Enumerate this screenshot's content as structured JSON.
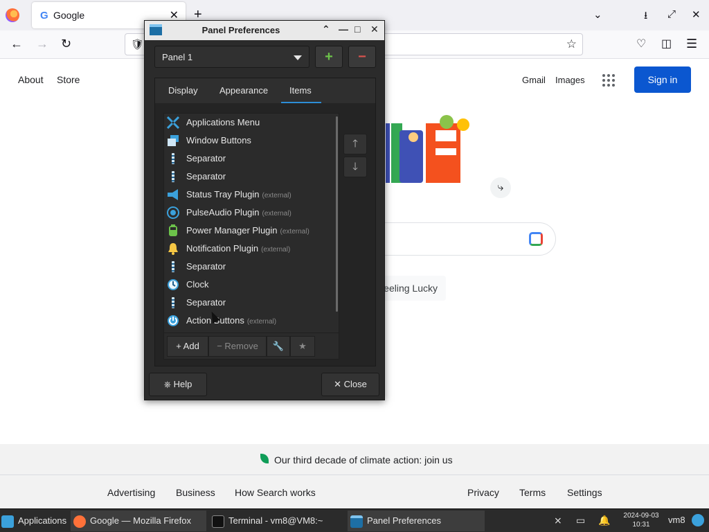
{
  "browser": {
    "tab_title": "Google",
    "favicon_letter": "G",
    "tab_close": "✕",
    "new_tab": "+",
    "icons": [
      "firefox-logo",
      "list-tabs-icon",
      "download-icon",
      "restore-icon",
      "close-icon",
      "back-icon",
      "forward-icon",
      "reload-icon",
      "shield-icon",
      "star-icon",
      "pocket-icon",
      "extensions-icon",
      "menu-icon"
    ]
  },
  "google": {
    "top_left": [
      "About",
      "Store"
    ],
    "top_right": [
      "Gmail",
      "Images"
    ],
    "sign_in": "Sign in",
    "lucky": "Feeling Lucky",
    "climate": "Our third decade of climate action: join us",
    "footer_left": [
      "Advertising",
      "Business",
      "How Search works"
    ],
    "footer_right": [
      "Privacy",
      "Terms",
      "Settings"
    ]
  },
  "dialog": {
    "title": "Panel Preferences",
    "panel_select": "Panel 1",
    "add_panel": "+",
    "remove_panel": "−",
    "tabs": [
      "Display",
      "Appearance",
      "Items"
    ],
    "active_tab": "Items",
    "items": [
      {
        "label": "Applications Menu",
        "ext": "",
        "icon": "applications-menu-icon"
      },
      {
        "label": "Window Buttons",
        "ext": "",
        "icon": "window-buttons-icon"
      },
      {
        "label": "Separator",
        "ext": "",
        "icon": "separator-icon"
      },
      {
        "label": "Separator",
        "ext": "",
        "icon": "separator-icon"
      },
      {
        "label": "Status Tray Plugin",
        "ext": "(external)",
        "icon": "status-tray-icon"
      },
      {
        "label": "PulseAudio Plugin",
        "ext": "(external)",
        "icon": "pulseaudio-icon"
      },
      {
        "label": "Power Manager Plugin",
        "ext": "(external)",
        "icon": "power-manager-icon"
      },
      {
        "label": "Notification Plugin",
        "ext": "(external)",
        "icon": "notification-bell-icon"
      },
      {
        "label": "Separator",
        "ext": "",
        "icon": "separator-icon"
      },
      {
        "label": "Clock",
        "ext": "",
        "icon": "clock-icon"
      },
      {
        "label": "Separator",
        "ext": "",
        "icon": "separator-icon"
      },
      {
        "label": "Action Buttons",
        "ext": "(external)",
        "icon": "action-buttons-icon"
      }
    ],
    "move_up": "🡑",
    "move_down": "🡓",
    "add": "+ Add",
    "remove": "− Remove",
    "help": "Help",
    "close": "✕ Close"
  },
  "taskbar": {
    "tasks": [
      {
        "label": "Applications ⠿",
        "active": false
      },
      {
        "label": "Google — Mozilla Firefox",
        "active": true
      },
      {
        "label": "Terminal - vm8@VM8:~",
        "active": false
      },
      {
        "label": "Panel Preferences",
        "active": true
      }
    ],
    "date": "2024-09-03",
    "time": "10:31",
    "user": "vm8"
  },
  "colors": {
    "sign_in_bg": "#0b57d0",
    "tab_underline": "#2d8ed6",
    "add_green": "#6cc24a",
    "remove_red": "#d9534f"
  }
}
